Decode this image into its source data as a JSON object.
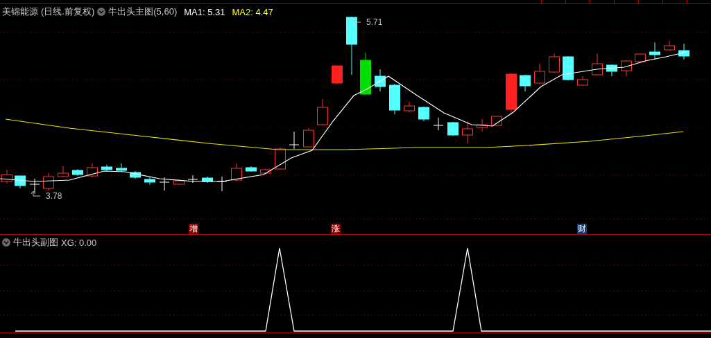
{
  "main_chart": {
    "stock_name": "美锦能源",
    "period_label": "(日线.前复权)",
    "indicator": "牛出头主图(5,60)",
    "ma_readings": [
      {
        "label": "MA1: 5.31",
        "color": "#ffffff"
      },
      {
        "label": "MA2: 4.47",
        "color": "#ffff00"
      }
    ],
    "price_labels": [
      "5.71",
      "3.78"
    ],
    "signal_markers": [
      {
        "label": "增",
        "color": "#8b0000"
      },
      {
        "label": "涨",
        "color": "#8b0000"
      },
      {
        "label": "财",
        "color": "#0b3b7a"
      }
    ]
  },
  "sub_chart": {
    "indicator": "牛出头副图",
    "reading": "XG: 0.00"
  }
}
